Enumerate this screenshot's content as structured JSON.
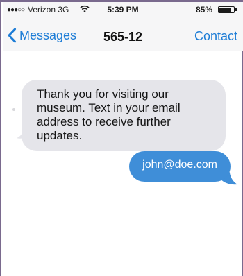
{
  "status_bar": {
    "signal_dots": "●●●○○",
    "carrier": "Verizon 3G",
    "time": "5:39 PM",
    "battery_percent": "85%",
    "battery_level": 0.85,
    "wifi_icon": "wifi-icon",
    "battery_icon": "battery-icon"
  },
  "nav": {
    "back_label": "Messages",
    "back_icon": "chevron-left-icon",
    "title": "565-12",
    "contact_label": "Contact"
  },
  "conversation": {
    "messages": [
      {
        "direction": "incoming",
        "text": "Thank you for visiting our museum. Text in your email address to receive further updates."
      },
      {
        "direction": "outgoing",
        "text": "john@doe.com"
      }
    ]
  },
  "colors": {
    "accent": "#1c7cd6",
    "incoming_bubble": "#e5e5ea",
    "outgoing_bubble": "#3f8ed8",
    "frame": "#7a6a8e"
  }
}
